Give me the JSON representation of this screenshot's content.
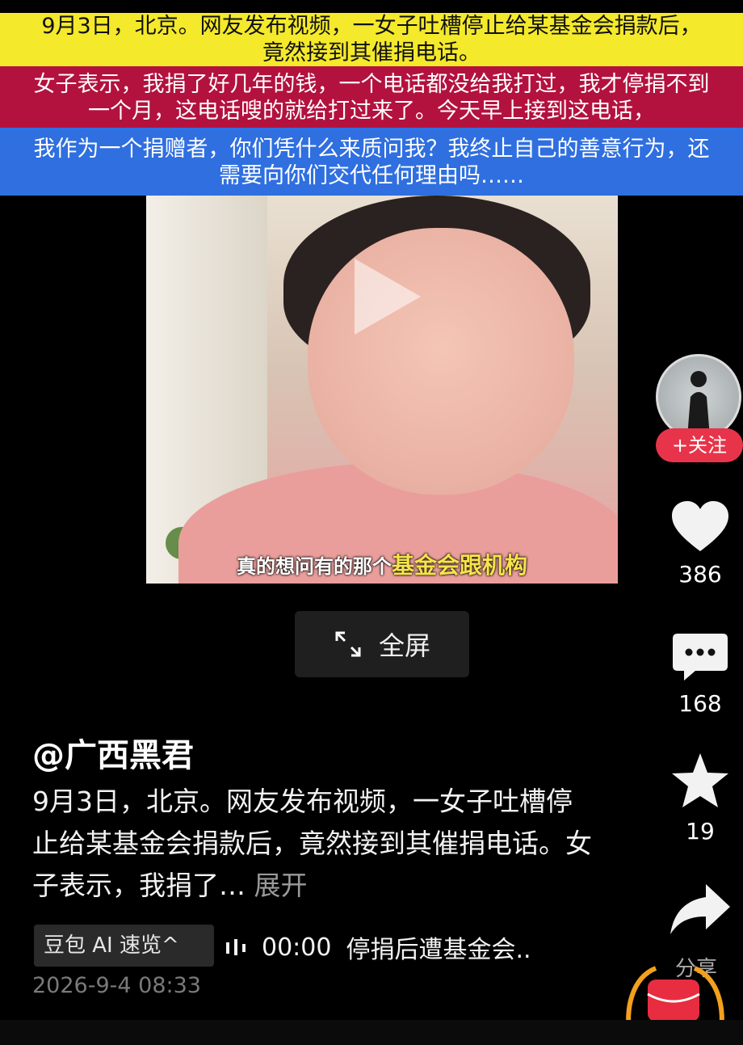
{
  "banners": {
    "yellow": [
      "9月3日，北京。网友发布视频，一女子吐槽停止给某基金会捐款后，",
      "竟然接到其催捐电话。"
    ],
    "red": [
      "女子表示，我捐了好几年的钱，一个电话都没给我打过，我才停捐不到",
      "一个月，这电话嗖的就给打过来了。今天早上接到这电话，"
    ],
    "blue": [
      "我作为一个捐赠者，你们凭什么来质问我？我终止自己的善意行为，还",
      "需要向你们交代任何理由吗……"
    ]
  },
  "video": {
    "subtitle_plain": "真的想问有的那个",
    "subtitle_highlight": "基金会跟机构"
  },
  "fullscreen_label": "全屏",
  "rail": {
    "follow_label": "+关注",
    "likes": "386",
    "comments": "168",
    "favorites": "19",
    "share_label": "分享"
  },
  "post": {
    "author": "@广西黑君",
    "description": "9月3日，北京。网友发布视频，一女子吐槽停止给某基金会捐款后，竟然接到其催捐电话。女子表示，我捐了…",
    "expand_label": "展开",
    "ai_chip": "豆包 AI 速览^",
    "audio_time": "00:00",
    "audio_title": "停捐后遭基金会..",
    "timestamp": "2026-9-4 08:33"
  },
  "colors": {
    "follow": "#e8344a",
    "yellow_banner": "#f4e92b",
    "red_banner": "#b3123e",
    "blue_banner": "#2f6fe0"
  }
}
